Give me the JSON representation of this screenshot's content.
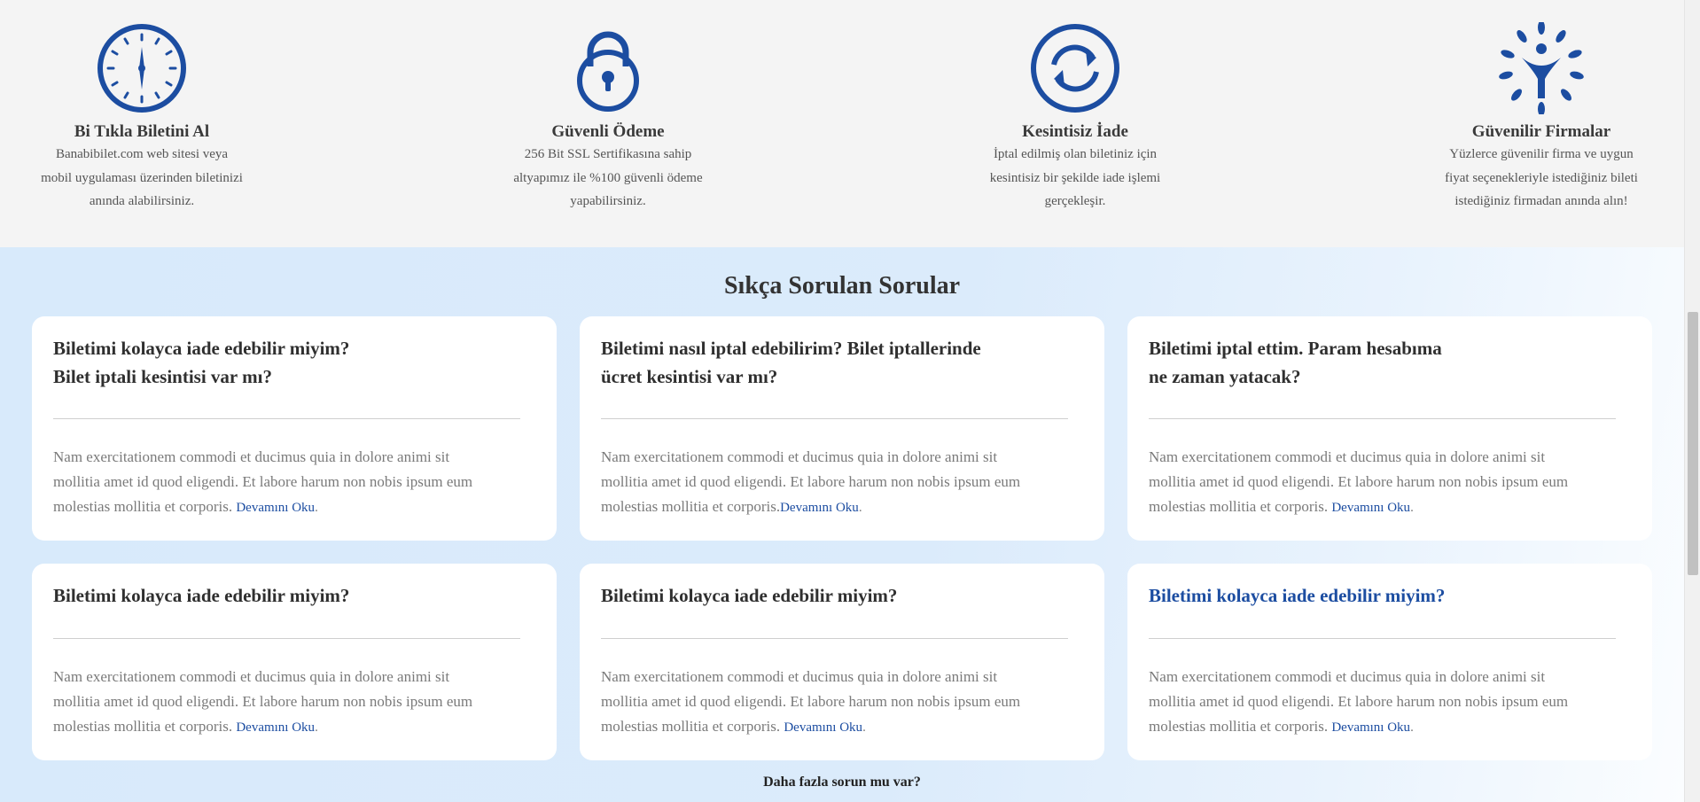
{
  "features": [
    {
      "icon": "clock-icon",
      "title": "Bi Tıkla Biletini Al",
      "lines": [
        "Banabibilet.com web sitesi veya",
        "mobil uygulaması üzerinden biletinizi",
        "anında alabilirsiniz."
      ]
    },
    {
      "icon": "lock-icon",
      "title": "Güvenli Ödeme",
      "lines": [
        "256 Bit SSL Sertifikasına sahip",
        "altyapımız ile %100 güvenli ödeme",
        "yapabilirsiniz."
      ]
    },
    {
      "icon": "refresh-icon",
      "title": "Kesintisiz İade",
      "lines": [
        "İptal edilmiş olan biletiniz için",
        "kesintisiz bir şekilde iade işlemi",
        "gerçekleşir."
      ]
    },
    {
      "icon": "people-leaves-icon",
      "title": "Güvenilir Firmalar",
      "lines": [
        "Yüzlerce güvenilir firma ve uygun",
        "fiyat seçenekleriyle istediğiniz bileti",
        "istediğiniz firmadan anında alın!"
      ]
    }
  ],
  "faq": {
    "title": "Sıkça Sorulan Sorular",
    "answer_lines": [
      "Nam exercitationem commodi et ducimus quia in dolore animi sit",
      "mollitia amet id quod eligendi. Et labore harum non nobis ipsum eum",
      "molestias mollitia et corporis."
    ],
    "read_more": "Devamını Oku",
    "cards": [
      {
        "q1": "Biletimi kolayca iade edebilir miyim?",
        "q2": "Bilet iptali kesintisi var mı?"
      },
      {
        "q1": "Biletimi nasıl iptal edebilirim? Bilet iptallerinde",
        "q2": "ücret kesintisi var mı?"
      },
      {
        "q1": "Biletimi iptal ettim. Param hesabıma",
        "q2": "ne zaman yatacak?"
      },
      {
        "q1": "Biletimi kolayca iade edebilir miyim?",
        "q2": ""
      },
      {
        "q1": "Biletimi kolayca iade edebilir miyim?",
        "q2": ""
      },
      {
        "q1": "Biletimi kolayca iade edebilir miyim?",
        "q2": ""
      }
    ],
    "more_question": "Daha fazla sorun mu var?",
    "more_sub": ""
  },
  "colors": {
    "brand_blue": "#1c4da1",
    "faq_background": "#d8eafb"
  }
}
